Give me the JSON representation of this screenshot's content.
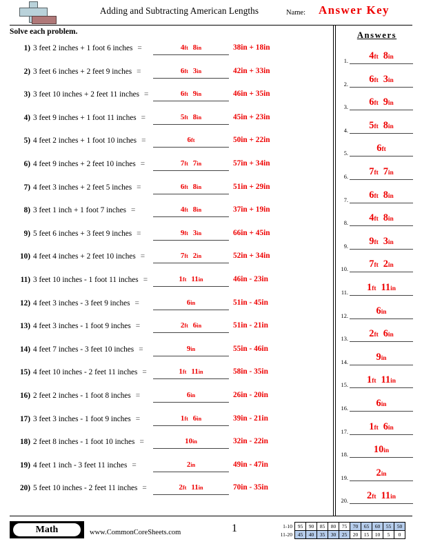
{
  "header": {
    "title": "Adding and Subtracting American Lengths",
    "name_label": "Name:",
    "answer_key": "Answer Key",
    "logo": "plus-block-logo"
  },
  "instructions": "Solve each problem.",
  "answers_header": "Answers",
  "colors": {
    "answer_red": "#ee0000",
    "rule": "#444444",
    "shade_blue": "#b6cdec"
  },
  "problems": [
    {
      "num": "1)",
      "text": "3 feet 2 inches + 1 foot 6 inches",
      "eq": "=",
      "ans_ft": "4",
      "ans_in": "8",
      "work": "38in + 18in"
    },
    {
      "num": "2)",
      "text": "3 feet 6 inches + 2 feet 9 inches",
      "eq": "=",
      "ans_ft": "6",
      "ans_in": "3",
      "work": "42in + 33in"
    },
    {
      "num": "3)",
      "text": "3 feet 10 inches + 2 feet 11 inches",
      "eq": "=",
      "ans_ft": "6",
      "ans_in": "9",
      "work": "46in + 35in"
    },
    {
      "num": "4)",
      "text": "3 feet 9 inches + 1 foot 11 inches",
      "eq": "=",
      "ans_ft": "5",
      "ans_in": "8",
      "work": "45in + 23in"
    },
    {
      "num": "5)",
      "text": "4 feet 2 inches + 1 foot 10 inches",
      "eq": "=",
      "ans_ft": "6",
      "ans_in": "",
      "work": "50in + 22in"
    },
    {
      "num": "6)",
      "text": "4 feet 9 inches + 2 feet 10 inches",
      "eq": "=",
      "ans_ft": "7",
      "ans_in": "7",
      "work": "57in + 34in"
    },
    {
      "num": "7)",
      "text": "4 feet 3 inches + 2 feet 5 inches",
      "eq": "=",
      "ans_ft": "6",
      "ans_in": "8",
      "work": "51in + 29in"
    },
    {
      "num": "8)",
      "text": "3 feet 1 inch + 1 foot 7 inches",
      "eq": "=",
      "ans_ft": "4",
      "ans_in": "8",
      "work": "37in + 19in"
    },
    {
      "num": "9)",
      "text": "5 feet 6 inches + 3 feet 9 inches",
      "eq": "=",
      "ans_ft": "9",
      "ans_in": "3",
      "work": "66in + 45in"
    },
    {
      "num": "10)",
      "text": "4 feet 4 inches + 2 feet 10 inches",
      "eq": "=",
      "ans_ft": "7",
      "ans_in": "2",
      "work": "52in + 34in"
    },
    {
      "num": "11)",
      "text": "3 feet 10 inches - 1 foot 11 inches",
      "eq": "=",
      "ans_ft": "1",
      "ans_in": "11",
      "work": "46in - 23in"
    },
    {
      "num": "12)",
      "text": "4 feet 3 inches - 3 feet 9 inches",
      "eq": "=",
      "ans_ft": "",
      "ans_in": "6",
      "work": "51in - 45in"
    },
    {
      "num": "13)",
      "text": "4 feet 3 inches - 1 foot 9 inches",
      "eq": "=",
      "ans_ft": "2",
      "ans_in": "6",
      "work": "51in - 21in"
    },
    {
      "num": "14)",
      "text": "4 feet 7 inches - 3 feet 10 inches",
      "eq": "=",
      "ans_ft": "",
      "ans_in": "9",
      "work": "55in - 46in"
    },
    {
      "num": "15)",
      "text": "4 feet 10 inches - 2 feet 11 inches",
      "eq": "=",
      "ans_ft": "1",
      "ans_in": "11",
      "work": "58in - 35in"
    },
    {
      "num": "16)",
      "text": "2 feet 2 inches - 1 foot 8 inches",
      "eq": "=",
      "ans_ft": "",
      "ans_in": "6",
      "work": "26in - 20in"
    },
    {
      "num": "17)",
      "text": "3 feet 3 inches - 1 foot 9 inches",
      "eq": "=",
      "ans_ft": "1",
      "ans_in": "6",
      "work": "39in - 21in"
    },
    {
      "num": "18)",
      "text": "2 feet 8 inches - 1 foot 10 inches",
      "eq": "=",
      "ans_ft": "",
      "ans_in": "10",
      "work": "32in - 22in"
    },
    {
      "num": "19)",
      "text": "4 feet 1 inch - 3 feet 11 inches",
      "eq": "=",
      "ans_ft": "",
      "ans_in": "2",
      "work": "49in - 47in"
    },
    {
      "num": "20)",
      "text": "5 feet 10 inches - 2 feet 11 inches",
      "eq": "=",
      "ans_ft": "2",
      "ans_in": "11",
      "work": "70in - 35in"
    }
  ],
  "answers": [
    {
      "num": "1.",
      "ft": "4",
      "in": "8"
    },
    {
      "num": "2.",
      "ft": "6",
      "in": "3"
    },
    {
      "num": "3.",
      "ft": "6",
      "in": "9"
    },
    {
      "num": "4.",
      "ft": "5",
      "in": "8"
    },
    {
      "num": "5.",
      "ft": "6",
      "in": ""
    },
    {
      "num": "6.",
      "ft": "7",
      "in": "7"
    },
    {
      "num": "7.",
      "ft": "6",
      "in": "8"
    },
    {
      "num": "8.",
      "ft": "4",
      "in": "8"
    },
    {
      "num": "9.",
      "ft": "9",
      "in": "3"
    },
    {
      "num": "10.",
      "ft": "7",
      "in": "2"
    },
    {
      "num": "11.",
      "ft": "1",
      "in": "11"
    },
    {
      "num": "12.",
      "ft": "",
      "in": "6"
    },
    {
      "num": "13.",
      "ft": "2",
      "in": "6"
    },
    {
      "num": "14.",
      "ft": "",
      "in": "9"
    },
    {
      "num": "15.",
      "ft": "1",
      "in": "11"
    },
    {
      "num": "16.",
      "ft": "",
      "in": "6"
    },
    {
      "num": "17.",
      "ft": "1",
      "in": "6"
    },
    {
      "num": "18.",
      "ft": "",
      "in": "10"
    },
    {
      "num": "19.",
      "ft": "",
      "in": "2"
    },
    {
      "num": "20.",
      "ft": "2",
      "in": "11"
    }
  ],
  "units": {
    "feet": "ft",
    "inches": "in"
  },
  "footer": {
    "subject": "Math",
    "url": "www.CommonCoreSheets.com",
    "page_number": "1",
    "score_rows": [
      {
        "label": "1-10",
        "cells": [
          {
            "v": "95",
            "shaded": false
          },
          {
            "v": "90",
            "shaded": false
          },
          {
            "v": "85",
            "shaded": false
          },
          {
            "v": "80",
            "shaded": false
          },
          {
            "v": "75",
            "shaded": false
          },
          {
            "v": "70",
            "shaded": true
          },
          {
            "v": "65",
            "shaded": true
          },
          {
            "v": "60",
            "shaded": true
          },
          {
            "v": "55",
            "shaded": true
          },
          {
            "v": "50",
            "shaded": true
          }
        ]
      },
      {
        "label": "11-20",
        "cells": [
          {
            "v": "45",
            "shaded": true
          },
          {
            "v": "40",
            "shaded": true
          },
          {
            "v": "35",
            "shaded": true
          },
          {
            "v": "30",
            "shaded": true
          },
          {
            "v": "25",
            "shaded": true
          },
          {
            "v": "20",
            "shaded": false
          },
          {
            "v": "15",
            "shaded": false
          },
          {
            "v": "10",
            "shaded": false
          },
          {
            "v": "5",
            "shaded": false
          },
          {
            "v": "0",
            "shaded": false
          }
        ]
      }
    ]
  }
}
